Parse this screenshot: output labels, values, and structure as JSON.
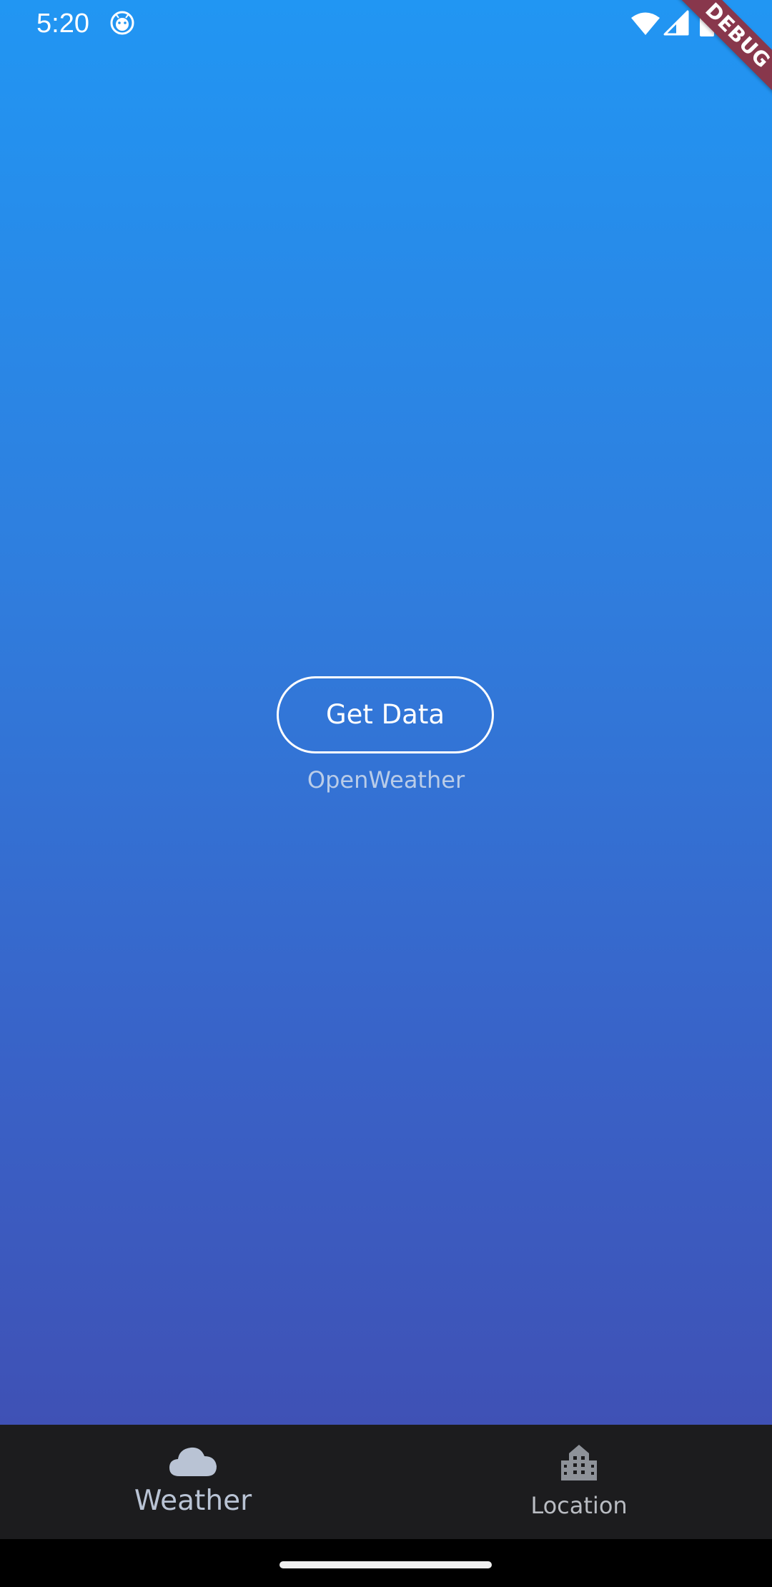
{
  "status_bar": {
    "time": "5:20",
    "app_icon": "android-face-icon",
    "wifi_icon": "wifi-icon",
    "signal_icon": "cell-signal-icon",
    "battery_icon": "battery-icon"
  },
  "debug_banner": {
    "label": "DEBUG",
    "color": "#88374c"
  },
  "main": {
    "button_label": "Get Data",
    "provider_label": "OpenWeather",
    "gradient_top": "#2196f3",
    "gradient_bottom": "#3f51b5"
  },
  "bottom_nav": {
    "items": [
      {
        "label": "Weather",
        "icon": "cloud-icon",
        "selected": true
      },
      {
        "label": "Location",
        "icon": "building-icon",
        "selected": false
      }
    ],
    "background": "#1c1c1e"
  }
}
